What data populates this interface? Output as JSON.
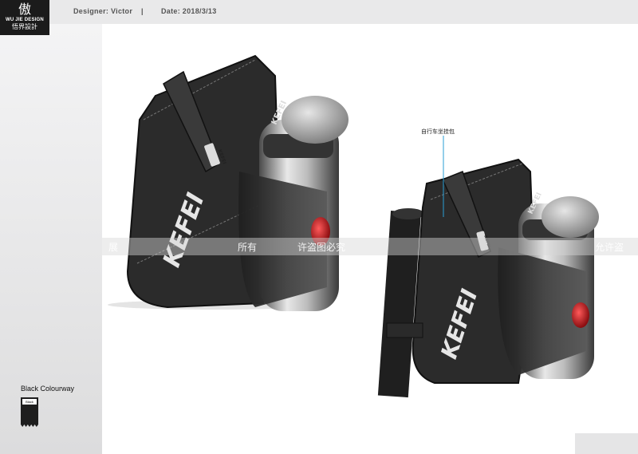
{
  "header": {
    "logo_mark": "傲",
    "logo_en": "WU JIE DESIGN",
    "logo_cn": "悟界設計",
    "designer": "Designer: Victor",
    "separator": "|",
    "date": "Date: 2018/3/13"
  },
  "sidebar": {
    "colourway_label": "Black Colourway",
    "swatch_label": "Black",
    "swatch_color": "#1e1e1e"
  },
  "product": {
    "brand": "KEFEI",
    "callout": "自行车坐挂包"
  },
  "watermark": {
    "left": "展",
    "middle_1": "所有",
    "middle_2": "许盗图必究",
    "right": "允许盗"
  },
  "colors": {
    "bag_body": "#2b2b2b",
    "bottle_cap": "#b9b9b9",
    "reflector": "#c0161b",
    "callout_line": "#2a9fd6"
  }
}
